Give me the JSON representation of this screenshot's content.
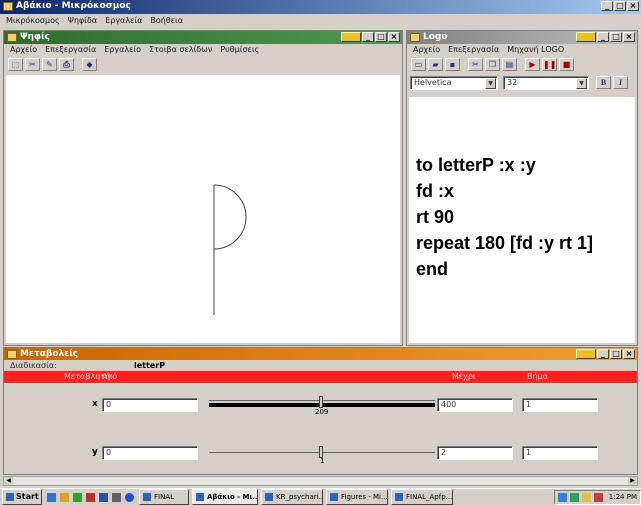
{
  "app": {
    "title": "Αβάκιο - Μικρόκοσμος",
    "menu": [
      "Μικρόκοσμος",
      "Ψηφίδα",
      "Εργαλεία",
      "Βοήθεια"
    ],
    "corner_icons": [
      "minimize-icon",
      "maximize-icon",
      "close-icon"
    ]
  },
  "turtle_window": {
    "title": "Ψηφίς",
    "menu": [
      "Αρχείο",
      "Επεξεργασία",
      "Εργαλείο",
      "Στοιβα σελίδων",
      "Ρυθμίσεις"
    ]
  },
  "logo_window": {
    "title": "Logo",
    "menu": [
      "Αρχείο",
      "Επεξεργασία",
      "Μηχανή LOGO"
    ],
    "font_name": "Helvetica",
    "font_size": "32",
    "bold_label": "B",
    "italic_label": "I",
    "code_lines": [
      "to letterP :x :y",
      "fd :x",
      "rt 90",
      "repeat 180 [fd :y rt 1]",
      "end"
    ]
  },
  "vars_window": {
    "title": "Μεταβολείς",
    "procedure_label": "Διαδικασία:",
    "procedure_name": "letterP",
    "headers": {
      "variable": "Μεταβλητή",
      "from": "Από",
      "to": "Μέχρι",
      "step": "Βήμα"
    },
    "rows": [
      {
        "name": "x",
        "from": "0",
        "slider_value": "209",
        "to": "400",
        "step": "1"
      },
      {
        "name": "y",
        "from": "0",
        "slider_value": "1",
        "to": "2",
        "step": "1"
      }
    ]
  },
  "taskbar": {
    "start": "Start",
    "tasks": [
      "FINAL",
      "Αβάκιο - Μι...",
      "KR_psychari...",
      "Figures - Mi...",
      "FINAL_Apfp..."
    ],
    "clock": "1:24 PM"
  },
  "colors": {
    "app_titlebar": "#0a246a",
    "turtle_titlebar": "#2f6b2f",
    "vars_titlebar": "#c86400",
    "header_bar": "#ff2020"
  }
}
